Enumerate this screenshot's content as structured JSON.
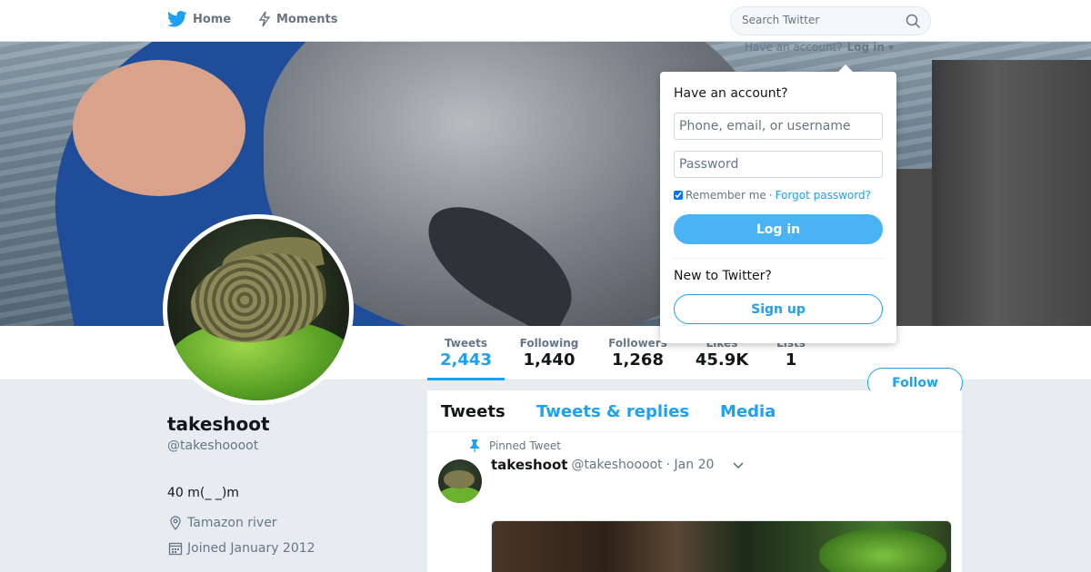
{
  "nav": {
    "home_label": "Home",
    "moments_label": "Moments",
    "search_placeholder": "Search Twitter"
  },
  "login_menu": {
    "prompt": "Have an account?",
    "login_label": "Log in",
    "title": "Have an account?",
    "username_placeholder": "Phone, email, or username",
    "password_placeholder": "Password",
    "remember_label": "Remember me",
    "separator": "·",
    "forgot_label": "Forgot password?",
    "login_button": "Log in",
    "new_prompt": "New to Twitter?",
    "signup_button": "Sign up"
  },
  "stats": [
    {
      "label": "Tweets",
      "value": "2,443"
    },
    {
      "label": "Following",
      "value": "1,440"
    },
    {
      "label": "Followers",
      "value": "1,268"
    },
    {
      "label": "Likes",
      "value": "45.9K"
    },
    {
      "label": "Lists",
      "value": "1"
    }
  ],
  "follow_label": "Follow",
  "profile": {
    "name": "takeshoot",
    "handle": "@takeshoooot",
    "bio": "40 m(_ _)m",
    "location": "Tamazon river",
    "joined": "Joined January 2012"
  },
  "tabs": [
    {
      "label": "Tweets"
    },
    {
      "label": "Tweets & replies"
    },
    {
      "label": "Media"
    }
  ],
  "pinned_tweet": {
    "pinned_label": "Pinned Tweet",
    "name": "takeshoot",
    "handle": "@takeshoooot",
    "date": "· Jan 20"
  },
  "colors": {
    "accent": "#1da1f2",
    "background": "#e6ecf0"
  }
}
